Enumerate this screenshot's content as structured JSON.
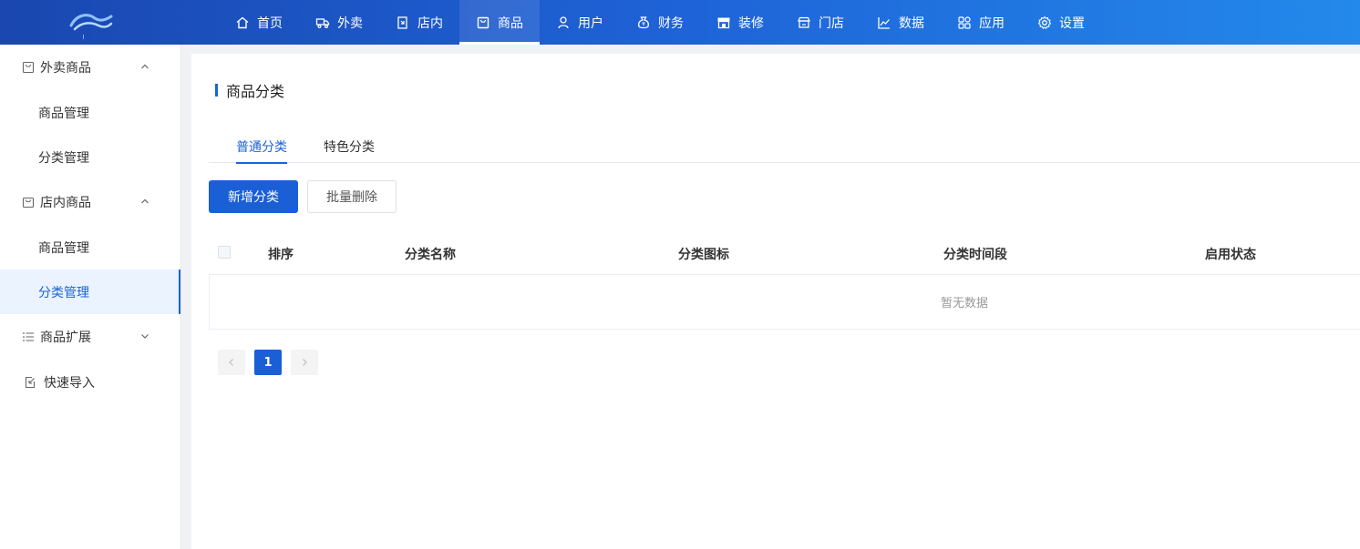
{
  "nav": {
    "items": [
      {
        "label": "首页",
        "icon": "home-icon"
      },
      {
        "label": "外卖",
        "icon": "delivery-icon"
      },
      {
        "label": "店内",
        "icon": "store-inside-icon"
      },
      {
        "label": "商品",
        "icon": "bag-icon",
        "active": true
      },
      {
        "label": "用户",
        "icon": "user-icon"
      },
      {
        "label": "财务",
        "icon": "money-bag-icon"
      },
      {
        "label": "装修",
        "icon": "shop-decor-icon"
      },
      {
        "label": "门店",
        "icon": "shop-icon"
      },
      {
        "label": "数据",
        "icon": "chart-icon"
      },
      {
        "label": "应用",
        "icon": "apps-icon"
      },
      {
        "label": "设置",
        "icon": "gear-icon"
      }
    ]
  },
  "sidebar": {
    "groups": [
      {
        "label": "外卖商品",
        "icon": "bag-icon",
        "expanded": true,
        "items": [
          {
            "label": "商品管理"
          },
          {
            "label": "分类管理"
          }
        ]
      },
      {
        "label": "店内商品",
        "icon": "bag-icon",
        "expanded": true,
        "items": [
          {
            "label": "商品管理"
          },
          {
            "label": "分类管理",
            "active": true
          }
        ]
      },
      {
        "label": "商品扩展",
        "icon": "list-icon",
        "expanded": false
      },
      {
        "label": "快速导入",
        "icon": "import-icon"
      }
    ]
  },
  "main": {
    "title": "商品分类",
    "tabs": [
      {
        "label": "普通分类",
        "active": true
      },
      {
        "label": "特色分类"
      }
    ],
    "actions": {
      "add_label": "新增分类",
      "batch_delete_label": "批量删除"
    },
    "table": {
      "columns": [
        "排序",
        "分类名称",
        "分类图标",
        "分类时间段",
        "启用状态"
      ],
      "empty_text": "暂无数据"
    },
    "pagination": {
      "current": "1"
    }
  },
  "colors": {
    "primary": "#1a5fd6",
    "accent": "#1a63d8"
  }
}
